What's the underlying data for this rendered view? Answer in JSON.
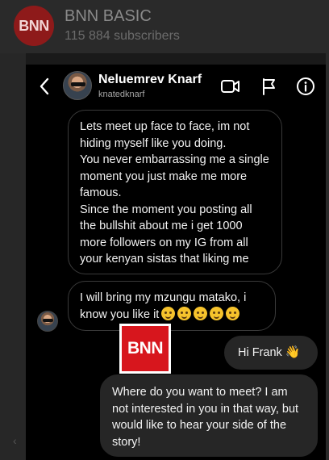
{
  "channel": {
    "logo_text": "BNN",
    "name": "BNN BASIC",
    "subscribers": "115 884 subscribers"
  },
  "dm": {
    "user": {
      "display_name": "Neluemrev Knarf",
      "handle": "knatedknarf"
    },
    "header_icons": [
      "back-chevron-icon",
      "video-call-icon",
      "flag-icon",
      "info-icon"
    ],
    "messages": [
      {
        "from": "them",
        "lines": [
          "Lets meet up face to face, im not hiding myself like you doing.",
          "You never embarrassing me a single moment you just make me more famous.",
          "Since the moment you posting all the bullshit about me i get 1000 more followers on my IG from all your kenyan sistas that liking me"
        ]
      },
      {
        "from": "them",
        "text": "I will bring my mzungu matako, i know you like it",
        "emojis": [
          "shushing-face-emoji",
          "smirk-emoji",
          "laughing-tears-emoji",
          "laughing-tears-emoji",
          "laughing-tears-emoji"
        ]
      },
      {
        "from": "me",
        "text": "Hi Frank",
        "emoji": "waving-hand-emoji"
      },
      {
        "from": "me",
        "text": "Where do you want to meet? I am not interested in you in that way, but would like to hear your side of the story!"
      }
    ]
  },
  "watermark": {
    "text": "BNN"
  },
  "colors": {
    "dm_background": "#000000",
    "sent_bubble": "#262626",
    "watermark_red": "#d7161d",
    "channel_logo": "#8e1a1a"
  }
}
